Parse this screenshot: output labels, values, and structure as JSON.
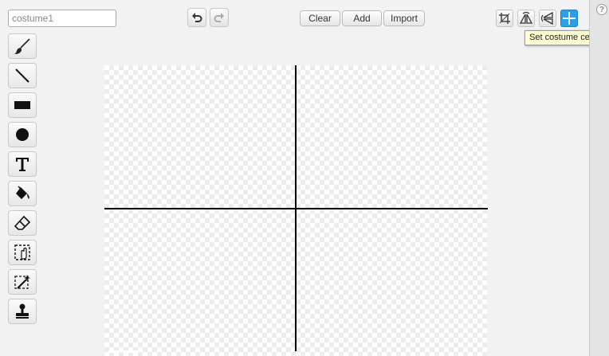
{
  "costume_name": {
    "value": "costume1",
    "placeholder": ""
  },
  "toolbar": {
    "undo_icon": "undo-arrow",
    "redo_icon": "redo-arrow",
    "clear_label": "Clear",
    "add_label": "Add",
    "import_label": "Import"
  },
  "canvas_tools": {
    "items": [
      "crop-icon",
      "flip-horizontal-icon",
      "flip-vertical-icon",
      "set-center-icon"
    ],
    "active": "set-center-icon",
    "active_color": "#2d9fe8"
  },
  "tooltip": {
    "text": "Set costume center"
  },
  "tools": [
    "brush-icon",
    "line-icon",
    "rectangle-icon",
    "ellipse-icon",
    "text-icon",
    "paint-bucket-icon",
    "eraser-icon",
    "select-icon",
    "magic-wand-icon",
    "stamp-icon"
  ],
  "help": {
    "label": "?"
  }
}
